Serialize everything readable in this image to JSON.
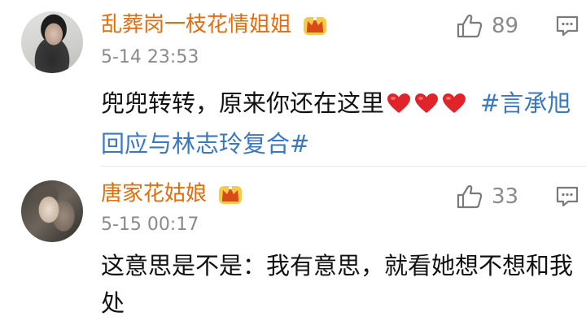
{
  "comments": [
    {
      "username": "乱葬岗一枝花情姐姐",
      "timestamp": "5-14  23:53",
      "text": "兜兜转转，原来你还在这里",
      "emoji": [
        "heart",
        "heart",
        "heart"
      ],
      "hashtag": "#言承旭回应与林志玲复合#",
      "likes": "89",
      "avatar_icon": "user-avatar",
      "badge_icon": "crown-vip-icon"
    },
    {
      "username": "唐家花姑娘",
      "timestamp": "5-15  00:17",
      "text": "这意思是不是：我有意思，就看她想不想和我处",
      "likes": "33",
      "avatar_icon": "user-avatar",
      "badge_icon": "crown-vip-icon"
    }
  ],
  "colors": {
    "username": "#e86b0a",
    "timestamp": "#8a8a8a",
    "hashtag": "#3b78c2",
    "heart": "#e0242a",
    "icon": "#7a7a7a",
    "crown": "#f2a41a"
  }
}
